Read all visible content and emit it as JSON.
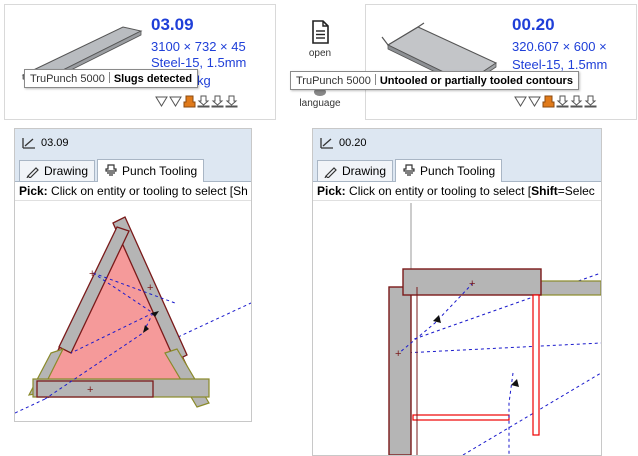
{
  "left_card": {
    "part_number": "03.09",
    "dimensions": "3100 × 732 × 45",
    "material": "Steel-15, 1.5mm",
    "weight_unit": "kg",
    "tooltip": {
      "app": "TruPunch 5000",
      "message": "Slugs detected"
    }
  },
  "right_card": {
    "part_number": "00.20",
    "dimensions": "320.607 × 600 ×",
    "material": "Steel-15, 1.5mm",
    "tooltip": {
      "app": "TruPunch 5000",
      "message": "Untooled or partially tooled contours"
    }
  },
  "center_buttons": {
    "open_label": "open",
    "language_label": "language"
  },
  "left_panel": {
    "title": "03.09",
    "tabs": [
      {
        "label": "Drawing"
      },
      {
        "label": "Punch Tooling"
      }
    ],
    "pick_label": "Pick:",
    "pick_text": " Click on entity or tooling to select [Sh"
  },
  "right_panel": {
    "title": "00.20",
    "tabs": [
      {
        "label": "Drawing"
      },
      {
        "label": "Punch Tooling"
      }
    ],
    "pick_label": "Pick:",
    "pick_text": " Click on entity or tooling to select [",
    "pick_shift": "Shift",
    "pick_tail": "=Selec"
  },
  "colors": {
    "accent_blue": "#1f3fd8",
    "triangle_fill": "#f59a9a",
    "tool_gray": "#b5b5b5",
    "tool_border": "#7a1a1a",
    "olive": "#8a8a2a",
    "warning_orange": "#e07a1a",
    "path_blue": "#1a1acc"
  },
  "icons": [
    "file-icon",
    "globe-icon",
    "drawing-icon",
    "punch-tooling-icon",
    "status-icon"
  ]
}
